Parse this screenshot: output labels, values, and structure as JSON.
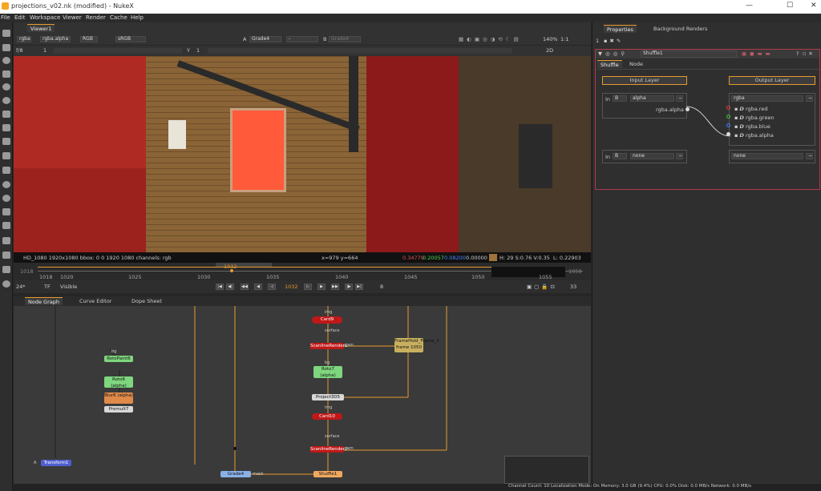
{
  "window": {
    "title": "projections_v02.nk (modified) - NukeX",
    "minimize": "—",
    "maximize": "☐",
    "close": "✕"
  },
  "menu": [
    "File",
    "Edit",
    "Workspace",
    "Viewer",
    "Render",
    "Cache",
    "Help"
  ],
  "viewer": {
    "tab": "Viewer1",
    "layer": "rgba",
    "channel": "rgba.alpha",
    "display": "RGB",
    "colorspace": "sRGB",
    "input_a_label": "A",
    "input_a": "Grade4",
    "input_sep": "-",
    "input_b_label": "B",
    "input_b": "Grade4",
    "zoom": "140%",
    "ratio": "1:1",
    "frame_step": "f/8",
    "frame_left": "1",
    "y_label": "Y",
    "y_value": "1",
    "mode_2d": "2D",
    "info_left": "HD_1080 1920x1080  bbox: 0 0 1920 1080 channels: rgb",
    "info_xy": "x=979 y=664",
    "info_r": "0.34779",
    "info_g": "0.20057",
    "info_b": "0.08200",
    "info_a": "0.00000",
    "info_hsv": "H: 29 S:0.76 V:0.35",
    "info_l": "L: 0.22903",
    "swatch_color": "#a0723c"
  },
  "timeline": {
    "start": "1018",
    "ticks": [
      "1018",
      "1020",
      "1025",
      "1030",
      "1035",
      "1040",
      "1045",
      "1050",
      "1055"
    ],
    "current": "1032",
    "end": "1059",
    "fps": "24*",
    "tf": "TF",
    "visible": "Visible",
    "frame_field": "1032",
    "step": "8",
    "end_frame": "33"
  },
  "nodegraph": {
    "tabs": [
      "Node Graph",
      "Curve Editor",
      "Dope Sheet"
    ],
    "status": "Channel Count: 10  Localization Mode: On  Memory: 3.0 GB (9.4%)  CPU: 0.0%  Disk: 0.0 MB/s  Network: 0.0 MB/s",
    "nodes": {
      "card9": "Card9",
      "scanline1": "ScanlineRender1",
      "roto7": "Roto7 (alpha)",
      "project3d": "Project3D5",
      "card10": "Card10",
      "scanline2": "ScanlineRender2",
      "shuffle1": "Shuffle1",
      "grade4": "Grade4",
      "frameheld": "FrameHold_Frame_1 frame 1050",
      "rotopaint6": "RotoPaint6",
      "roto6": "Roto6 (alpha)",
      "blur6": "Blur6 (alpha)",
      "premult7": "Premult7",
      "transform": "Transform1",
      "bg": "bg",
      "img": "img",
      "cam": "cam",
      "obj": "obj/scn",
      "surface": "surface",
      "mask": "mask",
      "a_label": "A"
    }
  },
  "properties": {
    "tabs": [
      "Properties",
      "Background Renders"
    ],
    "count": "1",
    "node_name": "Shuffle1",
    "subtabs": [
      "Shuffle",
      "Node"
    ],
    "input_layer": "Input Layer",
    "output_layer": "Output Layer",
    "in1_label": "In",
    "in1_idx": "B",
    "in1_layer": "alpha",
    "in1_channel": "rgba.alpha",
    "out_layer": "rgba",
    "out_channels": [
      "rgba.red",
      "rgba.green",
      "rgba.blue",
      "rgba.alpha"
    ],
    "in2_label": "In",
    "in2_idx": "B",
    "in2_layer": "none",
    "out2_layer": "none",
    "help": "?",
    "btn_minus": "−"
  }
}
